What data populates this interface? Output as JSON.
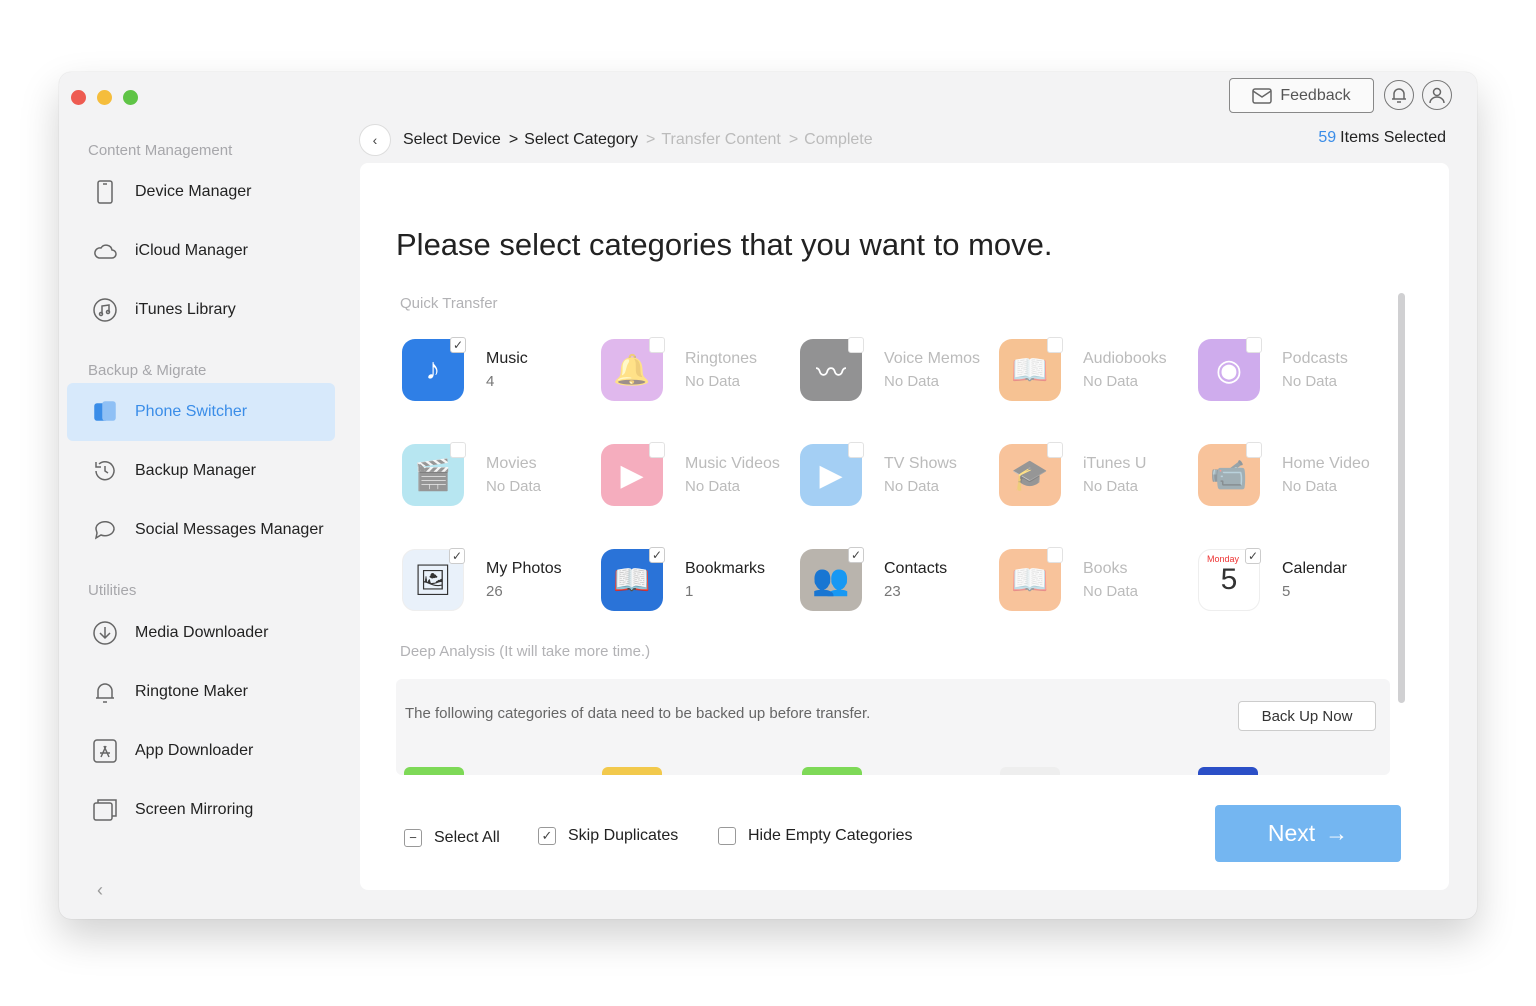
{
  "sidebar": {
    "sections": [
      {
        "title": "Content Management",
        "items": [
          {
            "label": "Device Manager",
            "icon": "device-icon"
          },
          {
            "label": "iCloud Manager",
            "icon": "cloud-icon"
          },
          {
            "label": "iTunes Library",
            "icon": "music-library-icon"
          }
        ]
      },
      {
        "title": "Backup & Migrate",
        "items": [
          {
            "label": "Phone Switcher",
            "icon": "phone-switcher-icon",
            "active": true
          },
          {
            "label": "Backup Manager",
            "icon": "backup-icon"
          },
          {
            "label": "Social Messages Manager",
            "icon": "chat-icon"
          }
        ]
      },
      {
        "title": "Utilities",
        "items": [
          {
            "label": "Media Downloader",
            "icon": "download-icon"
          },
          {
            "label": "Ringtone Maker",
            "icon": "bell-icon"
          },
          {
            "label": "App Downloader",
            "icon": "app-store-icon"
          },
          {
            "label": "Screen Mirroring",
            "icon": "mirror-icon"
          }
        ]
      }
    ]
  },
  "topbar": {
    "feedback_label": "Feedback"
  },
  "breadcrumb": {
    "steps": [
      "Select Device",
      "Select Category",
      "Transfer Content",
      "Complete"
    ]
  },
  "selection": {
    "count": "59",
    "label": "Items Selected"
  },
  "main": {
    "headline": "Please select categories that you want to move.",
    "quick_label": "Quick Transfer",
    "deep_label": "Deep Analysis (It will take more time.)",
    "deep_notice": "The following categories of data need to be backed up before transfer.",
    "backup_button": "Back Up Now"
  },
  "categories": [
    {
      "name": "Music",
      "sub": "4",
      "checked": true,
      "empty": false,
      "color": "#2f7fe6",
      "glyph": "♪"
    },
    {
      "name": "Ringtones",
      "sub": "No Data",
      "checked": false,
      "empty": true,
      "color": "#c77fe0",
      "glyph": "🔔"
    },
    {
      "name": "Voice Memos",
      "sub": "No Data",
      "checked": false,
      "empty": true,
      "color": "#3a3a3c",
      "glyph": "〰"
    },
    {
      "name": "Audiobooks",
      "sub": "No Data",
      "checked": false,
      "empty": true,
      "color": "#f0913b",
      "glyph": "📖"
    },
    {
      "name": "Podcasts",
      "sub": "No Data",
      "checked": false,
      "empty": true,
      "color": "#a86ae0",
      "glyph": "◉"
    },
    {
      "name": "Movies",
      "sub": "No Data",
      "checked": false,
      "empty": true,
      "color": "#7dd3e6",
      "glyph": "🎬"
    },
    {
      "name": "Music Videos",
      "sub": "No Data",
      "checked": false,
      "empty": true,
      "color": "#ee6b8a",
      "glyph": "▶"
    },
    {
      "name": "TV Shows",
      "sub": "No Data",
      "checked": false,
      "empty": true,
      "color": "#5aa9ec",
      "glyph": "▶"
    },
    {
      "name": "iTunes U",
      "sub": "No Data",
      "checked": false,
      "empty": true,
      "color": "#f3934a",
      "glyph": "🎓"
    },
    {
      "name": "Home Video",
      "sub": "No Data",
      "checked": false,
      "empty": true,
      "color": "#f3934a",
      "glyph": "📹"
    },
    {
      "name": "My Photos",
      "sub": "26",
      "checked": true,
      "empty": false,
      "color": "#e9f1fa",
      "glyph": "🖼"
    },
    {
      "name": "Bookmarks",
      "sub": "1",
      "checked": true,
      "empty": false,
      "color": "#2a73d8",
      "glyph": "📖"
    },
    {
      "name": "Contacts",
      "sub": "23",
      "checked": true,
      "empty": false,
      "color": "#b9b4ad",
      "glyph": "👥"
    },
    {
      "name": "Books",
      "sub": "No Data",
      "checked": false,
      "empty": true,
      "color": "#f3934a",
      "glyph": "📖"
    },
    {
      "name": "Calendar",
      "sub": "5",
      "checked": true,
      "empty": false,
      "color": "#ffffff",
      "glyph": "5",
      "badge": "Monday"
    }
  ],
  "footer": {
    "select_all": "Select All",
    "skip_duplicates": "Skip Duplicates",
    "hide_empty": "Hide Empty Categories",
    "next_label": "Next"
  }
}
